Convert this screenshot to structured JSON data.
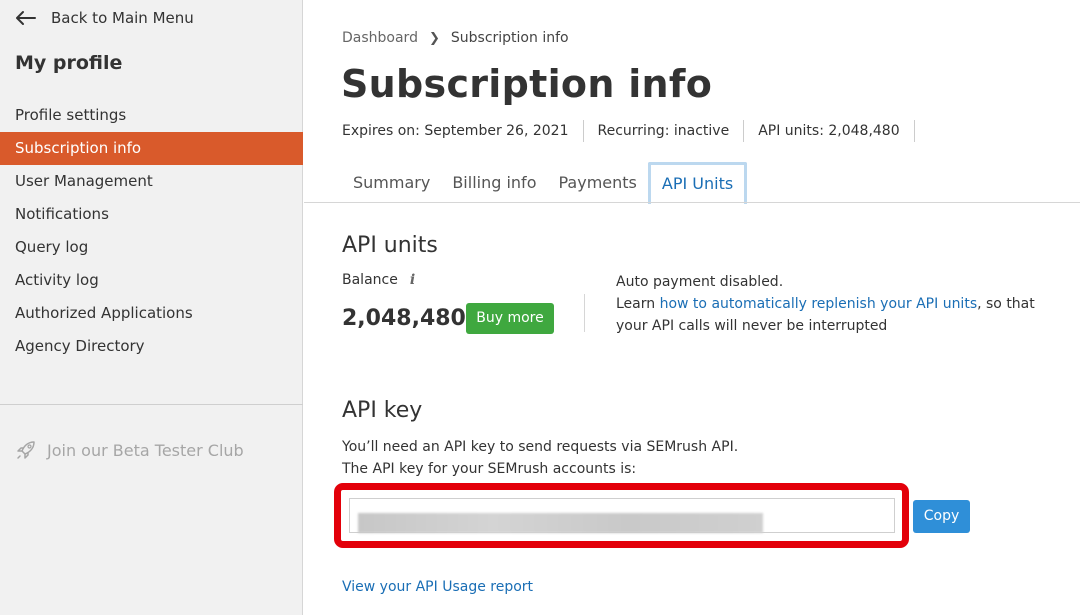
{
  "sidebar": {
    "back_label": "Back to Main Menu",
    "title": "My profile",
    "items": [
      {
        "label": "Profile settings",
        "active": false
      },
      {
        "label": "Subscription info",
        "active": true
      },
      {
        "label": "User Management",
        "active": false
      },
      {
        "label": "Notifications",
        "active": false
      },
      {
        "label": "Query log",
        "active": false
      },
      {
        "label": "Activity log",
        "active": false
      },
      {
        "label": "Authorized Applications",
        "active": false
      },
      {
        "label": "Agency Directory",
        "active": false
      }
    ],
    "beta_label": "Join our Beta Tester Club"
  },
  "breadcrumb": {
    "items": [
      "Dashboard",
      "Subscription info"
    ]
  },
  "page": {
    "title": "Subscription info",
    "expires": "Expires on: September 26, 2021",
    "recurring": "Recurring: inactive",
    "api_units": "API units: 2,048,480"
  },
  "tabs": [
    {
      "label": "Summary",
      "active": false
    },
    {
      "label": "Billing info",
      "active": false
    },
    {
      "label": "Payments",
      "active": false
    },
    {
      "label": "API Units",
      "active": true
    }
  ],
  "api_units_section": {
    "heading": "API units",
    "balance_label": "Balance",
    "balance_value": "2,048,480",
    "buy_label": "Buy more",
    "auto_line1": "Auto payment disabled.",
    "auto_prefix": "Learn ",
    "auto_link": "how to automatically replenish your API units",
    "auto_suffix": ", so that your API calls will never be interrupted"
  },
  "api_key_section": {
    "heading": "API key",
    "desc_line1": "You’ll need an API key to send requests via SEMrush API.",
    "desc_line2": "The API key for your SEMrush accounts is:",
    "copy_label": "Copy",
    "usage_link": "View your API Usage report"
  },
  "colors": {
    "accent": "#d95a2b",
    "link": "#1a6eb5",
    "buy_button": "#3fa83f",
    "copy_button": "#2f8fd8",
    "highlight_frame": "#e3000a"
  }
}
